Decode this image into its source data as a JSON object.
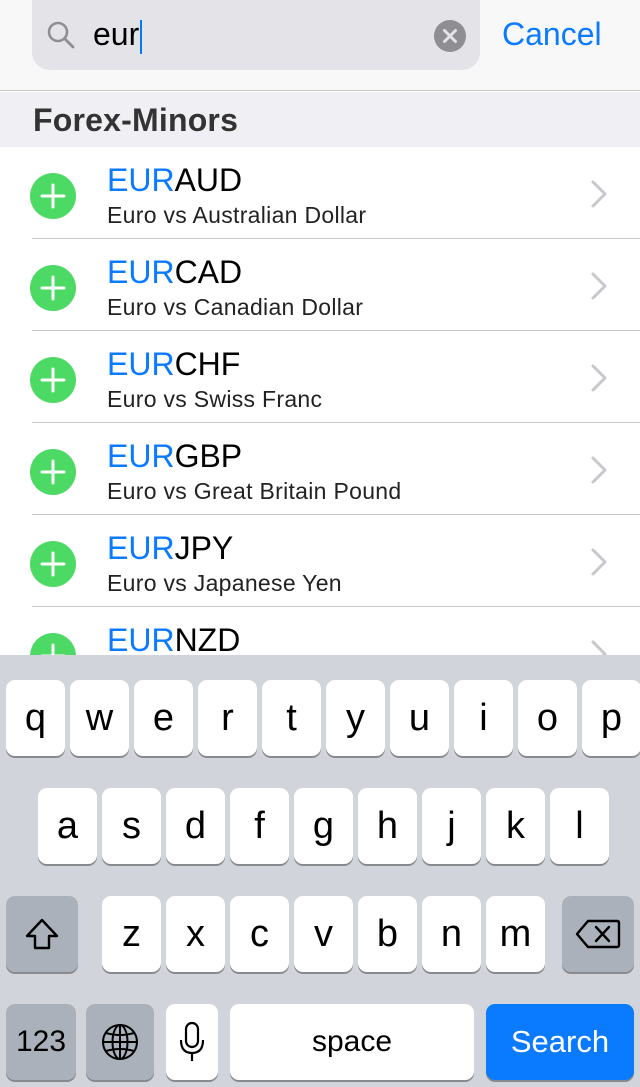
{
  "search": {
    "query": "eur",
    "cancel_label": "Cancel"
  },
  "section": {
    "title": "Forex-Minors"
  },
  "instruments": [
    {
      "highlight": "EUR",
      "rest": "AUD",
      "description": "Euro vs Australian Dollar"
    },
    {
      "highlight": "EUR",
      "rest": "CAD",
      "description": "Euro vs Canadian Dollar"
    },
    {
      "highlight": "EUR",
      "rest": "CHF",
      "description": "Euro vs Swiss Franc"
    },
    {
      "highlight": "EUR",
      "rest": "GBP",
      "description": "Euro vs Great Britain Pound"
    },
    {
      "highlight": "EUR",
      "rest": "JPY",
      "description": "Euro vs Japanese Yen"
    },
    {
      "highlight": "EUR",
      "rest": "NZD",
      "description": ""
    }
  ],
  "keyboard": {
    "row1": [
      "q",
      "w",
      "e",
      "r",
      "t",
      "y",
      "u",
      "i",
      "o",
      "p"
    ],
    "row2": [
      "a",
      "s",
      "d",
      "f",
      "g",
      "h",
      "j",
      "k",
      "l"
    ],
    "row3": [
      "z",
      "x",
      "c",
      "v",
      "b",
      "n",
      "m"
    ],
    "numbers_label": "123",
    "space_label": "space",
    "search_label": "Search"
  },
  "colors": {
    "accent": "#0a7aff",
    "add_green": "#4cd964",
    "keyboard_bg": "#d1d5db"
  },
  "icons": [
    "search-icon",
    "clear-icon",
    "add-icon",
    "chevron-right-icon",
    "shift-icon",
    "backspace-icon",
    "globe-icon",
    "microphone-icon"
  ]
}
